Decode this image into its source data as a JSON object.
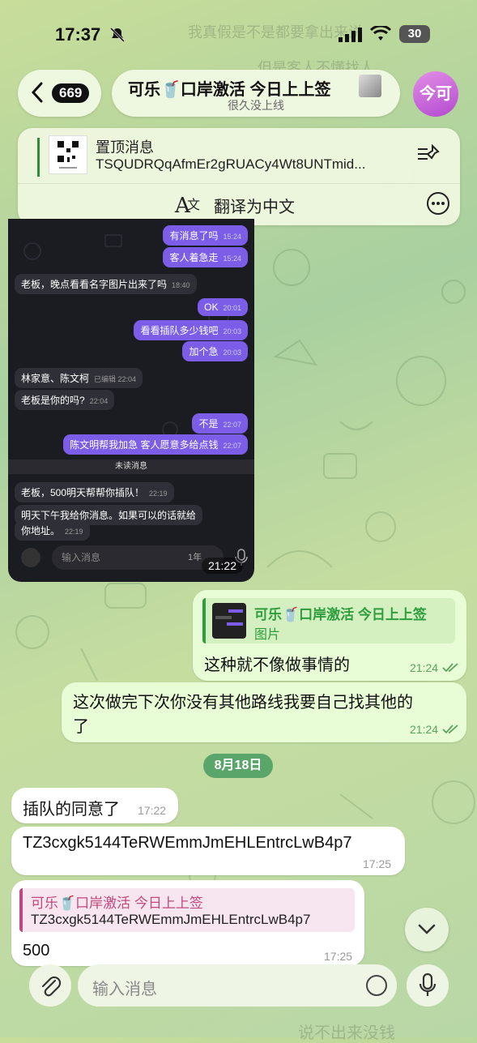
{
  "status_bar": {
    "time": "17:37",
    "battery": "30"
  },
  "header": {
    "back_count": "669",
    "title": "可乐🥤口岸激活 今日上上签",
    "subtitle": "很久没上线",
    "avatar_text": "今可"
  },
  "pinned": {
    "title": "置顶消息",
    "message": "TSQUDRQqAfmEr2gRUACy4Wt8UNTmid...",
    "translate_label": "翻译为中文"
  },
  "ghost_top": [
    "我真假是不是都要拿出来说",
    "但是客人不懂找人"
  ],
  "screenshot": {
    "messages": [
      {
        "text": "有消息了吗",
        "time": "15:24",
        "dir": "out"
      },
      {
        "text": "客人着急走",
        "time": "15:24",
        "dir": "out"
      },
      {
        "text": "老板，晚点看看名字图片出来了吗",
        "time": "18:40",
        "dir": "in"
      },
      {
        "text": "OK",
        "time": "20:01",
        "dir": "out"
      },
      {
        "text": "看看插队多少钱吧",
        "time": "20:03",
        "dir": "out"
      },
      {
        "text": "加个急",
        "time": "20:03",
        "dir": "out"
      },
      {
        "text": "林家意、陈文柯",
        "time": "已编辑 22:04",
        "dir": "in"
      },
      {
        "text": "老板是你的吗?",
        "time": "22:04",
        "dir": "in"
      },
      {
        "text": "不是",
        "time": "22:07",
        "dir": "out"
      },
      {
        "text": "陈文明帮我加急 客人愿意多给点钱",
        "time": "22:07",
        "dir": "out"
      },
      {
        "text": "老板，500明天帮帮你插队！",
        "time": "22:19",
        "dir": "in"
      },
      {
        "text": "明天下午我给你消息。如果可以的话就给",
        "time": "",
        "dir": "in"
      },
      {
        "text": "你地址。",
        "time": "22:19",
        "dir": "in"
      }
    ],
    "unread_label": "未读消息",
    "input_placeholder": "输入消息",
    "input_extra": "1年",
    "time": "21:22"
  },
  "msg1": {
    "reply_name": "可乐🥤口岸激活 今日上上签",
    "reply_sub": "图片",
    "text": "这种就不像做事情的",
    "time": "21:24"
  },
  "msg2": {
    "line1": "这次做完下次你没有其他路线我要自己找其他的",
    "line2": "了",
    "time": "21:24"
  },
  "date_chip": "8月18日",
  "msg3": {
    "text": "插队的同意了",
    "time": "17:22"
  },
  "msg4": {
    "text": "TZ3cxgk5144TeRWEmmJmEHLEntrcLwB4p7",
    "time": "17:25"
  },
  "msg5": {
    "reply_name": "可乐🥤口岸激活 今日上上签",
    "reply_sub": "TZ3cxgk5144TeRWEmmJmEHLEntrcLwB4p7",
    "text": "500",
    "time": "17:25"
  },
  "input": {
    "placeholder": "输入消息"
  },
  "ghost_bottom": [
    "说不出来没钱"
  ],
  "colors": {
    "accent": "#2e9d3e",
    "outgoing": "#e8fcd6",
    "avatar": "#c35fd9"
  }
}
